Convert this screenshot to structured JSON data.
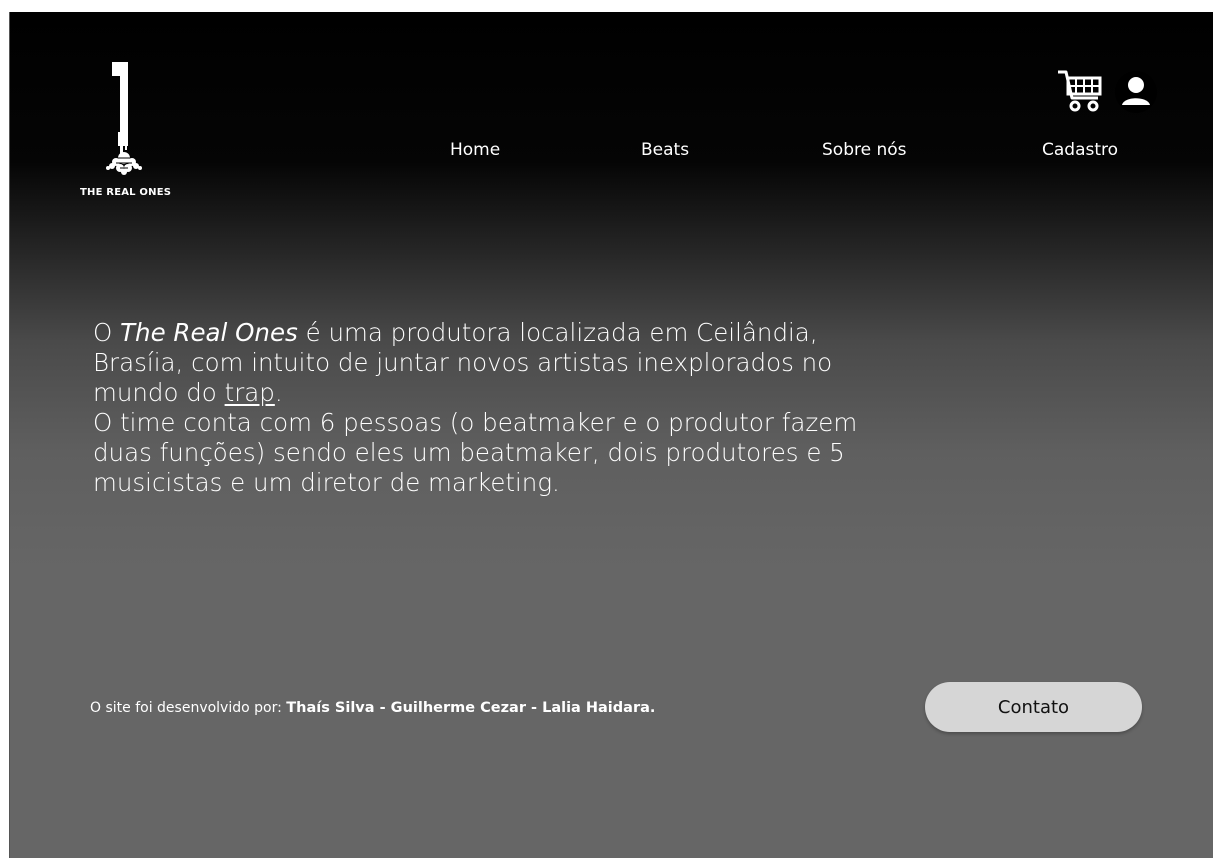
{
  "brand": {
    "logo_text": "THE REAL ONES",
    "logo_icon": "number-one-roots-logo"
  },
  "nav": {
    "home": "Home",
    "beats": "Beats",
    "sobre": "Sobre nós",
    "cadastro": "Cadastro"
  },
  "header_icons": {
    "cart": "shopping-cart-icon",
    "user": "user-account-icon"
  },
  "about": {
    "p1_a": "O ",
    "p1_brand": "The Real Ones",
    "p1_b": " é uma produtora localizada em Ceilândia, Brasíia, com intuito de juntar novos artistas inexplorados no mundo do ",
    "p1_link": "trap",
    "p1_c": ".",
    "p2": "O time conta com 6 pessoas (o beatmaker e o produtor fazem duas funções) sendo eles um beatmaker, dois produtores e 5 musicistas e um diretor de marketing."
  },
  "footer": {
    "prefix": "O site foi desenvolvido por: ",
    "developers": "Thaís Silva - Guilherme Cezar - Lalia Haidara.",
    "contact_label": "Contato"
  },
  "colors": {
    "text": "#ffffff",
    "button_bg": "#d6d6d6",
    "button_text": "#111111"
  }
}
